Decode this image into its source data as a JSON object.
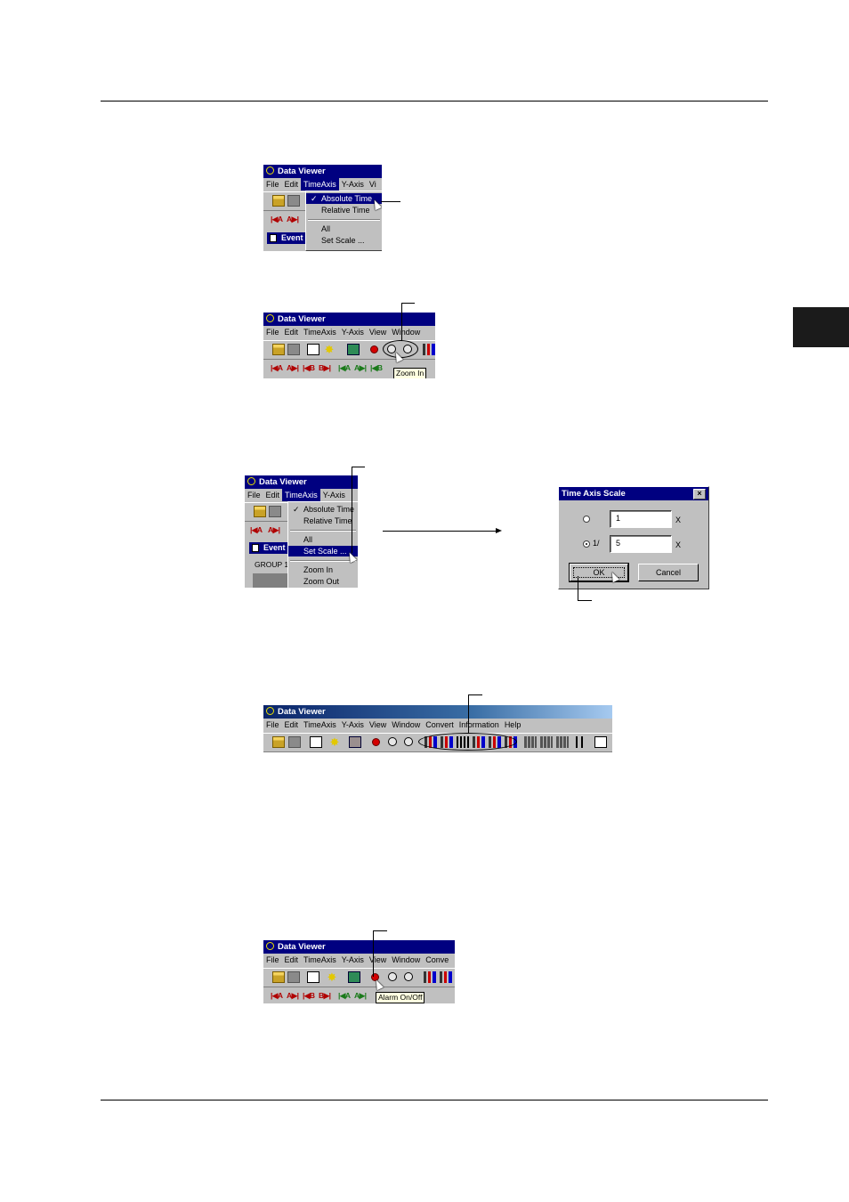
{
  "app": {
    "window_title": "Data Viewer",
    "menu_items": [
      "File",
      "Edit",
      "TimeAxis",
      "Y-Axis",
      "View",
      "Window",
      "Convert",
      "Information",
      "Help"
    ]
  },
  "shot1": {
    "menu_cut": "Vi",
    "timeaxis_menu": [
      "Absolute Time",
      "Relative Time",
      "All",
      "Set Scale ..."
    ],
    "doc_title": "Event"
  },
  "shot2": {
    "tooltip": "Zoom In"
  },
  "shot3": {
    "timeaxis_menu": [
      "Absolute Time",
      "Relative Time",
      "All",
      "Set Scale ...",
      "Zoom In",
      "Zoom Out"
    ],
    "doc_title": "Event",
    "group_label": "GROUP 1"
  },
  "dialog": {
    "title": "Time Axis Scale",
    "close": "×",
    "field1_value": "1",
    "field2_value": "5",
    "radio2_label": "1/",
    "unit": "X",
    "ok": "OK",
    "cancel": "Cancel"
  },
  "shot4": {
    "menu_cut": "Conve"
  },
  "shot5": {
    "tooltip": "Alarm On/Off"
  },
  "nav_buttons": [
    "|◀A",
    "A▶|",
    "|◀B",
    "B▶|",
    "|◀A",
    "A▶|",
    "|◀B",
    "B▶|"
  ],
  "colors": {
    "titlebar": "#000080",
    "face": "#c0c0c0",
    "tooltip": "#ffffe1"
  }
}
